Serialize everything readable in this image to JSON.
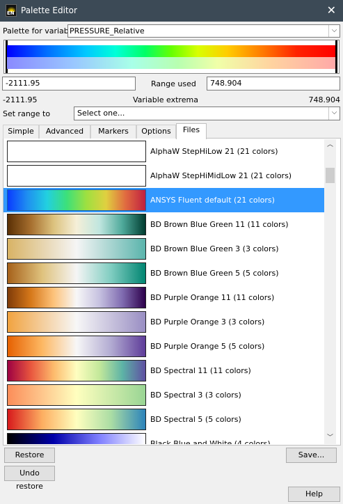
{
  "window": {
    "title": "Palette Editor",
    "app_icon_text": "EN"
  },
  "palette_for_variable": {
    "label": "Palette for variable",
    "value": "PRESSURE_Relative"
  },
  "range": {
    "min_value": "-2111.95",
    "range_used_label": "Range used",
    "max_value": "748.904"
  },
  "extrema": {
    "min": "-2111.95",
    "label": "Variable extrema",
    "max": "748.904"
  },
  "set_range": {
    "label": "Set range to",
    "value": "Select one..."
  },
  "tabs": [
    {
      "label": "Simple"
    },
    {
      "label": "Advanced"
    },
    {
      "label": "Markers"
    },
    {
      "label": "Options"
    },
    {
      "label": "Files"
    }
  ],
  "palettes": [
    {
      "name": "AlphaW StepHiLow 21 (21 colors)",
      "colors": [
        "#ffffff",
        "#ffffff"
      ]
    },
    {
      "name": "AlphaW StepHiMidLow 21 (21 colors)",
      "colors": [
        "#ffffff",
        "#ffffff"
      ]
    },
    {
      "name": "ANSYS Fluent default (21 colors)",
      "colors": [
        "#0a3cff",
        "#1f8ff0",
        "#22d0e0",
        "#3ce07a",
        "#9ee040",
        "#e0d040",
        "#e06a40",
        "#c02040"
      ],
      "selected": true
    },
    {
      "name": "BD Brown Blue Green 11 (11 colors)",
      "colors": [
        "#5a3005",
        "#a66e2e",
        "#dcc27e",
        "#f5efd8",
        "#c0e6df",
        "#4ea99a",
        "#003c30"
      ]
    },
    {
      "name": "BD Brown Blue Green 3 (3 colors)",
      "colors": [
        "#d8b365",
        "#f5f5f5",
        "#5ab4ac"
      ]
    },
    {
      "name": "BD Brown Blue Green 5 (5 colors)",
      "colors": [
        "#a6611a",
        "#dfc27d",
        "#f5f5f5",
        "#80cdc1",
        "#018571"
      ]
    },
    {
      "name": "BD Purple Orange 11 (11 colors)",
      "colors": [
        "#7f3b08",
        "#d6781a",
        "#fdc27a",
        "#f7f7f7",
        "#c6c1e0",
        "#7f6bb0",
        "#2d004b"
      ]
    },
    {
      "name": "BD Purple Orange 3 (3 colors)",
      "colors": [
        "#f1a340",
        "#f7f7f7",
        "#998ec3"
      ]
    },
    {
      "name": "BD Purple Orange 5 (5 colors)",
      "colors": [
        "#e66101",
        "#fdb863",
        "#f7f7f7",
        "#b2abd2",
        "#5e3c99"
      ]
    },
    {
      "name": "BD Spectral 11 (11 colors)",
      "colors": [
        "#9e0142",
        "#e8553e",
        "#fdba6c",
        "#fefec0",
        "#c3e89a",
        "#5db3a6",
        "#5e4fa2"
      ]
    },
    {
      "name": "BD Spectral 3 (3 colors)",
      "colors": [
        "#fc8d59",
        "#ffffbf",
        "#99d594"
      ]
    },
    {
      "name": "BD Spectral 5 (5 colors)",
      "colors": [
        "#d7191c",
        "#fdae61",
        "#ffffbf",
        "#abdda4",
        "#2b83ba"
      ]
    },
    {
      "name": "Black Blue and White (4 colors)",
      "colors": [
        "#000000",
        "#0000aa",
        "#8080ff",
        "#ffffff"
      ]
    }
  ],
  "buttons": {
    "restore": "Restore",
    "save": "Save...",
    "undo_restore": "Undo restore",
    "help": "Help"
  },
  "colors": {
    "selection": "#3399ff",
    "titlebar": "#3c4a56"
  }
}
